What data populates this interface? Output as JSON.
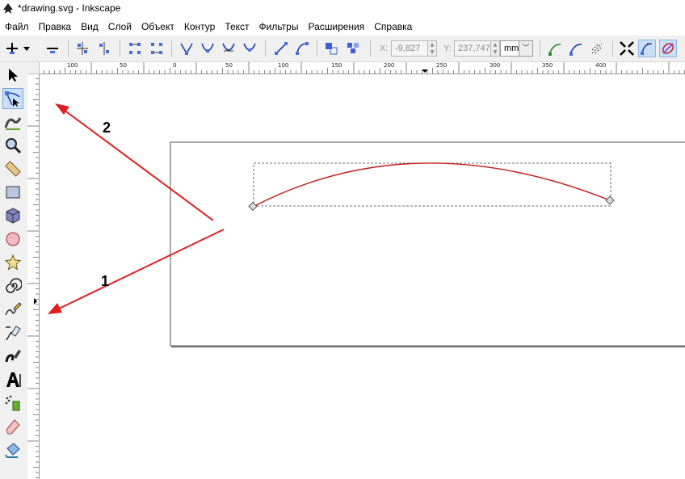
{
  "window": {
    "title": "*drawing.svg - Inkscape"
  },
  "menu": [
    "Файл",
    "Правка",
    "Вид",
    "Слой",
    "Объект",
    "Контур",
    "Текст",
    "Фильтры",
    "Расширения",
    "Справка"
  ],
  "toolbar": {
    "x_label": "X:",
    "x_value": "-9,827",
    "y_label": "Y:",
    "y_value": "237,747",
    "unit": "mm"
  },
  "hruler": {
    "labels": [
      "100",
      "50",
      "0",
      "50",
      "100",
      "150",
      "200",
      "250",
      "300",
      "350",
      "400"
    ]
  },
  "annotations": {
    "one": "1",
    "two": "2"
  },
  "colors": {
    "path": "#c21c1c",
    "arrow": "#e02020",
    "active_tool": "#c9dff5"
  },
  "tools": [
    "selector-icon",
    "node-editor-icon",
    "tweak-icon",
    "zoom-icon",
    "measure-icon",
    "rectangle-icon",
    "3d-box-icon",
    "ellipse-icon",
    "star-icon",
    "spiral-icon",
    "pencil-icon",
    "pen-icon",
    "calligraphy-icon",
    "text-icon",
    "spray-icon",
    "eraser-icon",
    "paint-bucket-icon"
  ]
}
